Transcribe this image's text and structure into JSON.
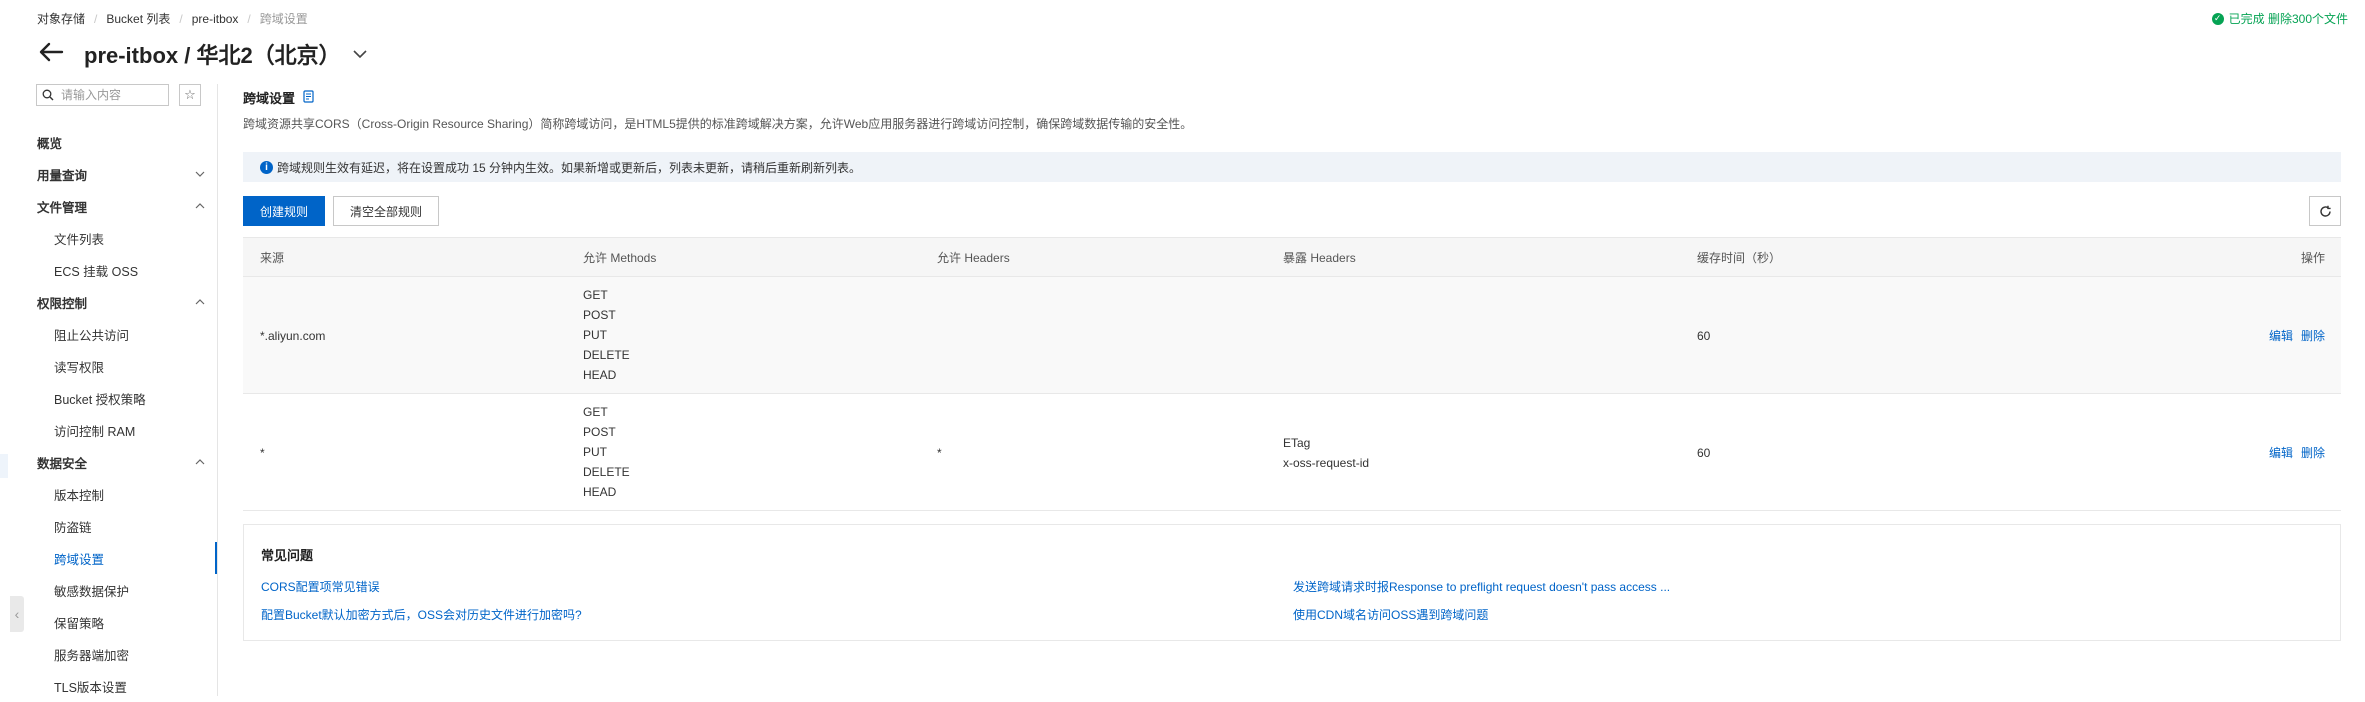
{
  "breadcrumb": [
    "对象存储",
    "Bucket 列表",
    "pre-itbox",
    "跨域设置"
  ],
  "status": {
    "text": "已完成 删除300个文件",
    "color": "#06a354"
  },
  "title": "pre-itbox / 华北2（北京）",
  "sidebar": {
    "search_placeholder": "请输入内容",
    "items": [
      {
        "label": "概览",
        "level": "top"
      },
      {
        "label": "用量查询",
        "level": "top",
        "chevron": "down"
      },
      {
        "label": "文件管理",
        "level": "top",
        "chevron": "up"
      },
      {
        "label": "文件列表",
        "level": "sub"
      },
      {
        "label": "ECS 挂载 OSS",
        "level": "sub"
      },
      {
        "label": "权限控制",
        "level": "top",
        "chevron": "up"
      },
      {
        "label": "阻止公共访问",
        "level": "sub"
      },
      {
        "label": "读写权限",
        "level": "sub"
      },
      {
        "label": "Bucket 授权策略",
        "level": "sub"
      },
      {
        "label": "访问控制 RAM",
        "level": "sub"
      },
      {
        "label": "数据安全",
        "level": "top",
        "chevron": "up"
      },
      {
        "label": "版本控制",
        "level": "sub"
      },
      {
        "label": "防盗链",
        "level": "sub"
      },
      {
        "label": "跨域设置",
        "level": "sub",
        "active": true
      },
      {
        "label": "敏感数据保护",
        "level": "sub"
      },
      {
        "label": "保留策略",
        "level": "sub"
      },
      {
        "label": "服务器端加密",
        "level": "sub"
      },
      {
        "label": "TLS版本设置",
        "level": "sub"
      }
    ]
  },
  "section": {
    "title": "跨域设置",
    "description": "跨域资源共享CORS（Cross-Origin Resource Sharing）简称跨域访问，是HTML5提供的标准跨域解决方案，允许Web应用服务器进行跨域访问控制，确保跨域数据传输的安全性。",
    "notice": "跨域规则生效有延迟，将在设置成功 15 分钟内生效。如果新增或更新后，列表未更新，请稍后重新刷新列表。"
  },
  "toolbar": {
    "create_label": "创建规则",
    "clear_label": "清空全部规则"
  },
  "table": {
    "headers": {
      "origin": "来源",
      "methods": "允许 Methods",
      "allow_headers": "允许 Headers",
      "expose_headers": "暴露 Headers",
      "cache": "缓存时间（秒）",
      "ops": "操作"
    },
    "rows": [
      {
        "origin": "*.aliyun.com",
        "methods": [
          "GET",
          "POST",
          "PUT",
          "DELETE",
          "HEAD"
        ],
        "allow_headers": "",
        "expose_headers": [],
        "cache": "60",
        "edit": "编辑",
        "delete": "删除"
      },
      {
        "origin": "*",
        "methods": [
          "GET",
          "POST",
          "PUT",
          "DELETE",
          "HEAD"
        ],
        "allow_headers": "*",
        "expose_headers": [
          "ETag",
          "x-oss-request-id"
        ],
        "cache": "60",
        "edit": "编辑",
        "delete": "删除"
      }
    ]
  },
  "faq": {
    "title": "常见问题",
    "links": [
      "CORS配置项常见错误",
      "发送跨域请求时报Response to preflight request doesn't pass access ...",
      "配置Bucket默认加密方式后，OSS会对历史文件进行加密吗?",
      "使用CDN域名访问OSS遇到跨域问题"
    ]
  },
  "colors": {
    "accent": "#0064c8",
    "success": "#06a354"
  }
}
